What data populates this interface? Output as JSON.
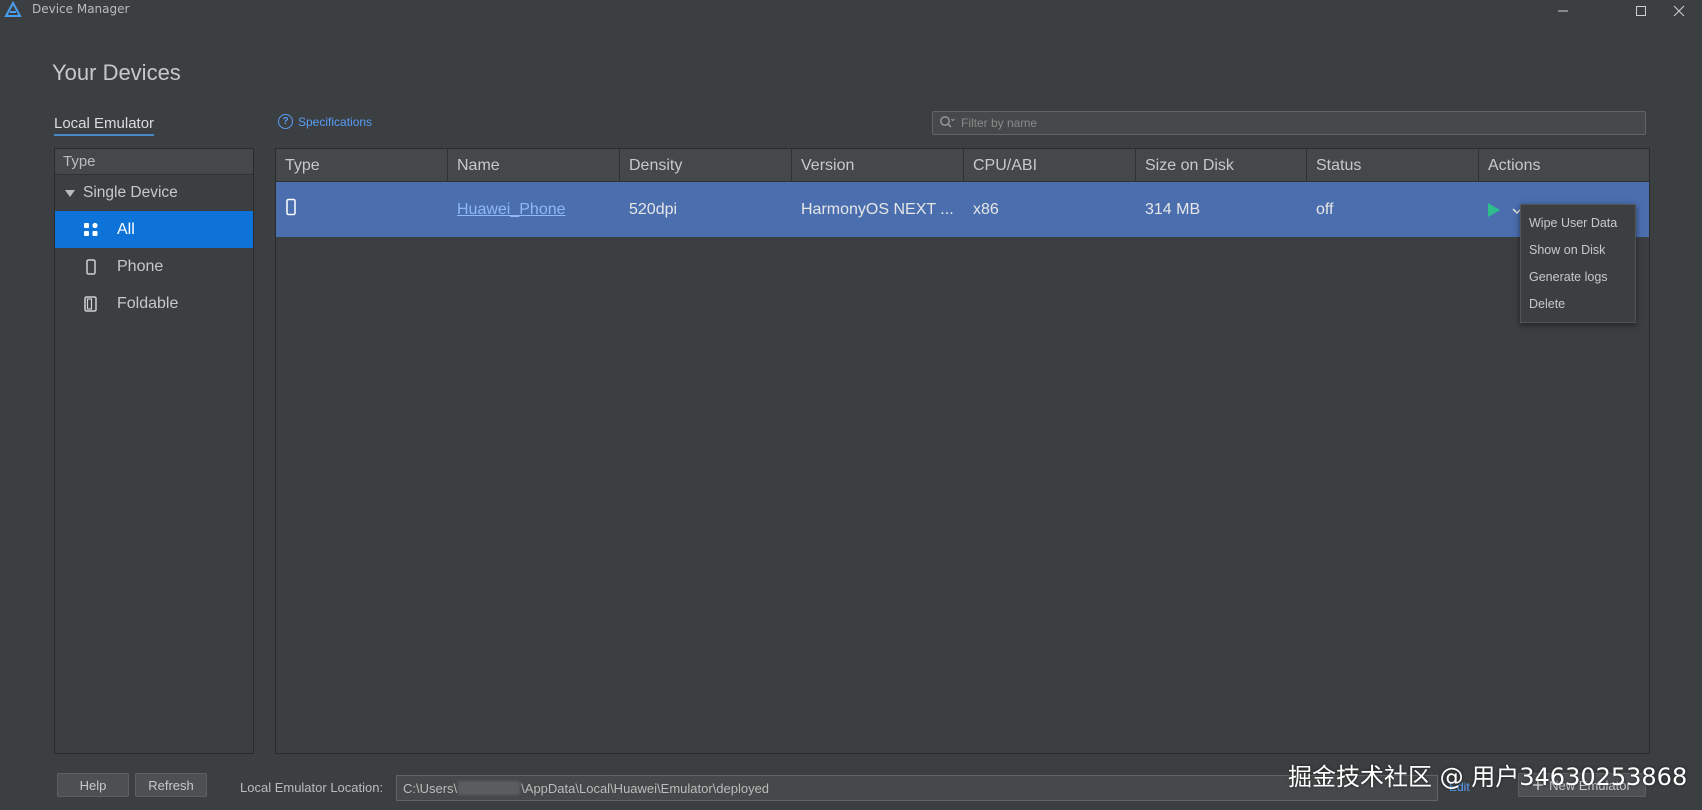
{
  "window": {
    "title": "Device Manager",
    "controls": [
      "minimize",
      "maximize",
      "close"
    ]
  },
  "page": {
    "title": "Your Devices"
  },
  "tabs": {
    "local_emulator": "Local Emulator"
  },
  "specifications": {
    "label": "Specifications",
    "icon": "help-circle-icon"
  },
  "filter": {
    "placeholder": "Filter by name",
    "value": "",
    "icon": "search-icon"
  },
  "left_panel": {
    "header": "Type",
    "group": {
      "label": "Single Device",
      "expanded": true
    },
    "items": [
      {
        "label": "All",
        "icon": "apps-grid-icon",
        "selected": true
      },
      {
        "label": "Phone",
        "icon": "phone-icon",
        "selected": false
      },
      {
        "label": "Foldable",
        "icon": "foldable-icon",
        "selected": false
      }
    ]
  },
  "table": {
    "columns": [
      "Type",
      "Name",
      "Density",
      "Version",
      "CPU/ABI",
      "Size on Disk",
      "Status",
      "Actions"
    ],
    "rows": [
      {
        "type_icon": "phone-icon",
        "name": "Huawei_Phone",
        "density": "520dpi",
        "version": "HarmonyOS NEXT ...",
        "cpu_abi": "x86",
        "size_on_disk": "314 MB",
        "status": "off",
        "selected": true
      }
    ],
    "row_actions": [
      "play-icon",
      "chevron-down-icon"
    ]
  },
  "context_menu": {
    "items": [
      "Wipe User Data",
      "Show on Disk",
      "Generate logs",
      "Delete"
    ]
  },
  "footer": {
    "help_label": "Help",
    "refresh_label": "Refresh",
    "location_label": "Local Emulator Location:",
    "location_prefix": "C:\\Users\\",
    "location_suffix": "\\AppData\\Local\\Huawei\\Emulator\\deployed",
    "edit_label": "Edit",
    "new_emulator_label": "New Emulator"
  },
  "watermark": "掘金技术社区 @ 用户3463025386​8",
  "colors": {
    "background": "#3c3f41",
    "selection": "#0d73d9",
    "row_selection": "#4b6eaf",
    "link": "#589df6",
    "play": "#2dbe8c"
  }
}
